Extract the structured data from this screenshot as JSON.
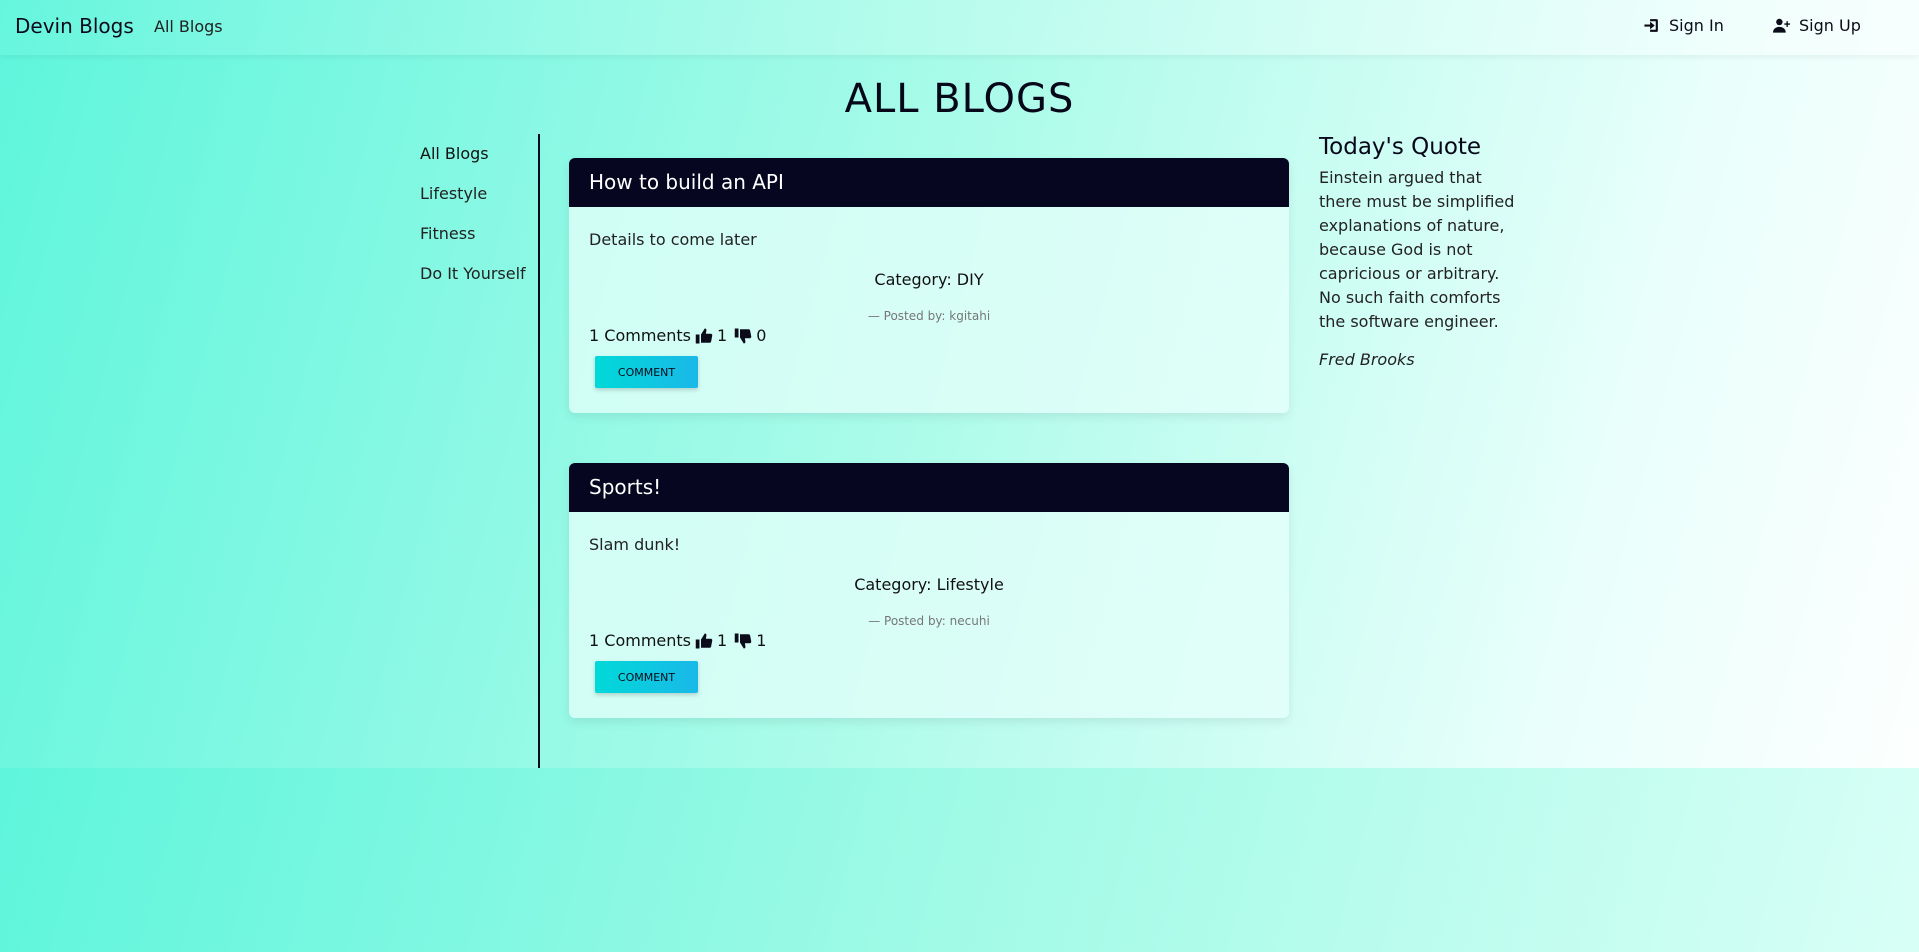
{
  "navbar": {
    "brand": "Devin Blogs",
    "all_blogs_link": "All Blogs",
    "sign_in": "Sign In",
    "sign_up": "Sign Up"
  },
  "page": {
    "title": "ALL BLOGS"
  },
  "sidebar": {
    "items": [
      {
        "label": "All Blogs"
      },
      {
        "label": "Lifestyle"
      },
      {
        "label": "Fitness"
      },
      {
        "label": "Do It Yourself"
      }
    ]
  },
  "posts": [
    {
      "title": "How to build an API",
      "body": "Details to come later",
      "category": "Category: DIY",
      "author": "— Posted by: kgitahi",
      "comments": "1 Comments",
      "likes": "1",
      "dislikes": "0",
      "button": "COMMENT"
    },
    {
      "title": "Sports!",
      "body": "Slam dunk!",
      "category": "Category: Lifestyle",
      "author": "— Posted by: necuhi",
      "comments": "1 Comments",
      "likes": "1",
      "dislikes": "1",
      "button": "COMMENT"
    }
  ],
  "quote": {
    "heading": "Today's Quote",
    "text": "Einstein argued that there must be simplified explanations of nature, because God is not capricious or arbitrary. No such faith comforts the software engineer.",
    "author": "Fred Brooks"
  },
  "colors": {
    "header_bg": "#060620",
    "button_gradient_start": "#00d9d9",
    "button_gradient_end": "#1ab8e8",
    "page_gradient_start": "#5ef5dc"
  },
  "icons": {
    "sign_in": "sign-in-icon",
    "sign_up": "user-plus-icon",
    "like": "thumbs-up-icon",
    "dislike": "thumbs-down-icon"
  }
}
